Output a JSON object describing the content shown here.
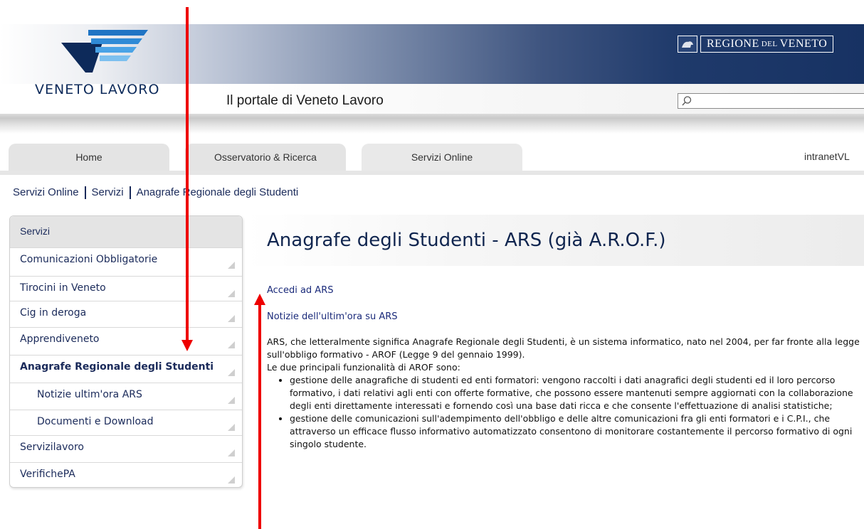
{
  "header": {
    "brand": "VENETO LAVORO",
    "portal_title": "Il portale di Veneto Lavoro",
    "region_main": "REGIONE",
    "region_small": "DEL",
    "region_end": "VENETO",
    "search_placeholder": ""
  },
  "tabs": [
    {
      "label": "Home"
    },
    {
      "label": "Osservatorio & Ricerca"
    },
    {
      "label": "Servizi Online"
    }
  ],
  "intranet_label": "intranetVL",
  "breadcrumb": [
    "Servizi Online",
    "Servizi",
    "Anagrafe Regionale degli Studenti"
  ],
  "sidebar": {
    "header": "Servizi",
    "items": [
      {
        "label": "Comunicazioni Obbligatorie"
      },
      {
        "label": "Tirocini in Veneto"
      },
      {
        "label": "Cig in deroga"
      },
      {
        "label": "Apprendiveneto"
      },
      {
        "label": "Anagrafe Regionale degli Studenti"
      },
      {
        "label": "Notizie ultim'ora ARS"
      },
      {
        "label": "Documenti e Download"
      },
      {
        "label": "Servizilavoro"
      },
      {
        "label": "VerifichePA"
      }
    ]
  },
  "main": {
    "title": "Anagrafe degli Studenti - ARS (già A.R.O.F.)",
    "link_access": "Accedi ad ARS",
    "link_news": "Notizie dell'ultim'ora su ARS",
    "intro": "ARS, che letteralmente significa Anagrafe Regionale degli Studenti, è un sistema informatico, nato nel 2004,  per far fronte alla legge sull'obbligo formativo - AROF (Legge 9 del gennaio 1999).",
    "functions_intro": "Le due principali funzionalità di AROF sono:",
    "bullets": [
      "gestione delle anagrafiche di studenti ed enti formatori: vengono raccolti i dati anagrafici degli studenti ed il loro percorso formativo, i dati relativi agli enti con offerte formative, che possono essere mantenuti sempre aggiornati con la collaborazione degli enti direttamente interessati e fornendo così una base dati ricca e che consente l'effettuazione di analisi statistiche;",
      "gestione delle comunicazioni sull'adempimento dell'obbligo e delle altre comunicazioni fra gli enti formatori e i C.P.I., che attraverso un efficace flusso informativo automatizzato consentono di monitorare costantemente il percorso formativo di ogni singolo studente."
    ]
  },
  "colors": {
    "arrow": "#ee0000",
    "link": "#1a2a7a",
    "title": "#10254f",
    "header_dark": "#173263"
  }
}
